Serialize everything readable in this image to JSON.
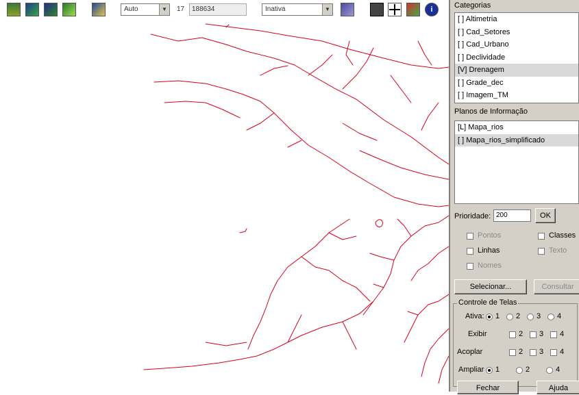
{
  "toolbar": {
    "mode_value": "Auto",
    "scale_number": "17",
    "scale_value": "188634",
    "layer_state_value": "Inativa"
  },
  "panel": {
    "categories_header": "Categorias",
    "categories": [
      {
        "label": "[ ] Altimetria",
        "selected": false
      },
      {
        "label": "[ ] Cad_Setores",
        "selected": false
      },
      {
        "label": "[ ] Cad_Urbano",
        "selected": false
      },
      {
        "label": "[ ] Declividade",
        "selected": false
      },
      {
        "label": "[V] Drenagem",
        "selected": true
      },
      {
        "label": "[ ] Grade_dec",
        "selected": false
      },
      {
        "label": "[ ] Imagem_TM",
        "selected": false
      }
    ],
    "planes_header": "Planos de Informação",
    "planes": [
      {
        "label": "[L] Mapa_rios",
        "selected": false
      },
      {
        "label": "[ ] Mapa_rios_simplificado",
        "selected": true
      }
    ],
    "priority_label": "Prioridade:",
    "priority_value": "200",
    "ok_label": "OK",
    "checkboxes": {
      "pontos": "Pontos",
      "classes": "Classes",
      "linhas": "Linhas",
      "texto": "Texto",
      "nomes": "Nomes"
    },
    "select_button": "Selecionar...",
    "compute_button": "Consultar",
    "screen_control_title": "Controle de Telas",
    "ativa_label": "Ativa:",
    "exibir_label": "Exibir",
    "acoplar_label": "Acoplar",
    "ampliar_label": "Ampliar",
    "n1": "1",
    "n2": "2",
    "n3": "3",
    "n4": "4",
    "close_button": "Fechar",
    "help_button": "Ajuda"
  },
  "colors": {
    "river": "#d9001b",
    "panel_bg": "#d4d0c8",
    "list_selected": "#d9d9d9"
  },
  "icons": [
    "layers-icon",
    "map-icon",
    "globe-icon",
    "pencil-icon",
    "tile-icon",
    "table-icon",
    "print-icon",
    "crosshair-icon",
    "query-icon",
    "info-icon"
  ]
}
